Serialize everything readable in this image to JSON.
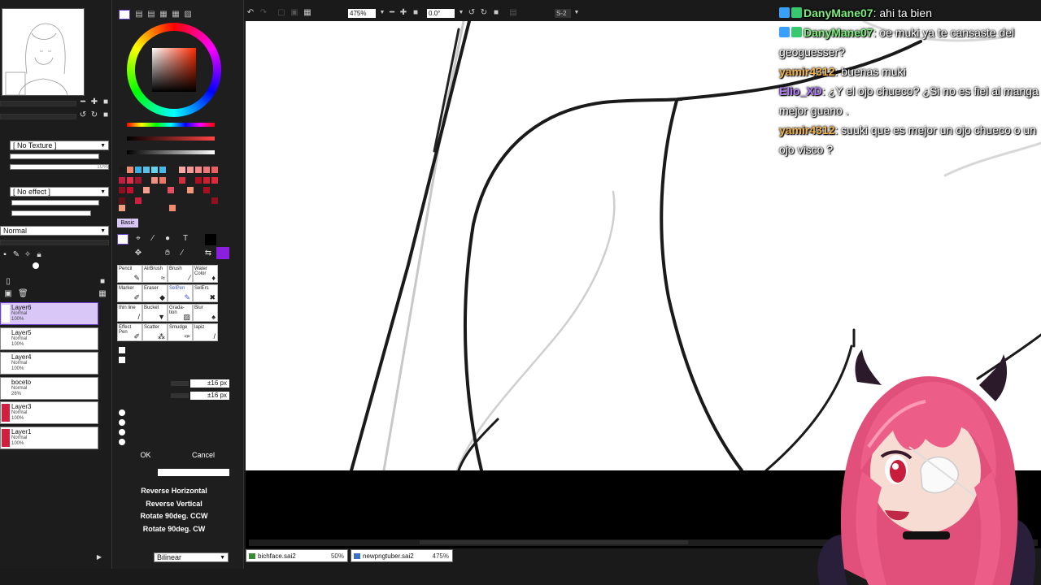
{
  "layer_panel": {
    "texture_dropdown": "[ No Texture ]",
    "texture_value": "10%",
    "effect_dropdown": "[ No effect ]",
    "blend_mode": "Normal",
    "layers": [
      {
        "name": "Layer6",
        "mode": "Normal",
        "opacity": "100%",
        "active": true
      },
      {
        "name": "Layer5",
        "mode": "Normal",
        "opacity": "100%",
        "active": false
      },
      {
        "name": "Layer4",
        "mode": "Normal",
        "opacity": "100%",
        "active": false
      },
      {
        "name": "boceto",
        "mode": "Normal",
        "opacity": "26%",
        "active": false
      },
      {
        "name": "Layer3",
        "mode": "Normal",
        "opacity": "100%",
        "active": false
      },
      {
        "name": "Layer1",
        "mode": "Normal",
        "opacity": "100%",
        "active": false
      }
    ]
  },
  "tool_panel": {
    "palette_tab": "Basic",
    "tools": [
      [
        "Pencil",
        "AirBrush",
        "Brush",
        "Water Color"
      ],
      [
        "Marker",
        "Eraser",
        "SelPen",
        "SelErs"
      ],
      [
        "thin line",
        "Bucket",
        "Grada-tion",
        "Blur"
      ],
      [
        "Effect Pen",
        "Scatter",
        "Smudge",
        "lapiz"
      ]
    ],
    "selected_tool": "SelPen",
    "distance_fields": [
      "±16 px",
      "±16 px"
    ],
    "ok_label": "OK",
    "cancel_label": "Cancel",
    "reverse_horizontal": "Reverse Horizontal",
    "reverse_vertical": "Reverse Vertical",
    "rotate_ccw": "Rotate 90deg. CCW",
    "rotate_cw": "Rotate 90deg. CW",
    "interpolation": "Bilinear"
  },
  "toolbar": {
    "zoom": "475%",
    "angle": "0.0°",
    "stabilizer": "S-2"
  },
  "tabs": [
    {
      "file": "bichface.sai2",
      "zoom": "50%"
    },
    {
      "file": "newpngtuber.sai2",
      "zoom": "475%"
    }
  ],
  "chat": [
    {
      "user": "DanyMane07",
      "text": ": ahi ta bien",
      "color": "#7cf07c",
      "badges": [
        "#3aa0ff",
        "#38c870"
      ]
    },
    {
      "user": "DanyMane07",
      "text": ": oe muki ya te cansaste del geoguesser?",
      "color": "#7cf07c",
      "badges": [
        "#3aa0ff",
        "#38c870"
      ]
    },
    {
      "user": "yamir4312",
      "text": ": buenas muki",
      "color": "#f2b24a",
      "badges": []
    },
    {
      "user": "Elio_XD",
      "text": ": ¿Y el ojo chueco? ¿Si no es fiel al manga mejor guano .",
      "color": "#b57cff",
      "badges": []
    },
    {
      "user": "yamir4312",
      "text": ": suuki que es mejor un ojo chueco o un ojo visco ?",
      "color": "#f2b24a",
      "badges": []
    }
  ],
  "colors": {
    "accent_purple": "#8a1fe0",
    "layer_selected": "#d9c8f7"
  }
}
